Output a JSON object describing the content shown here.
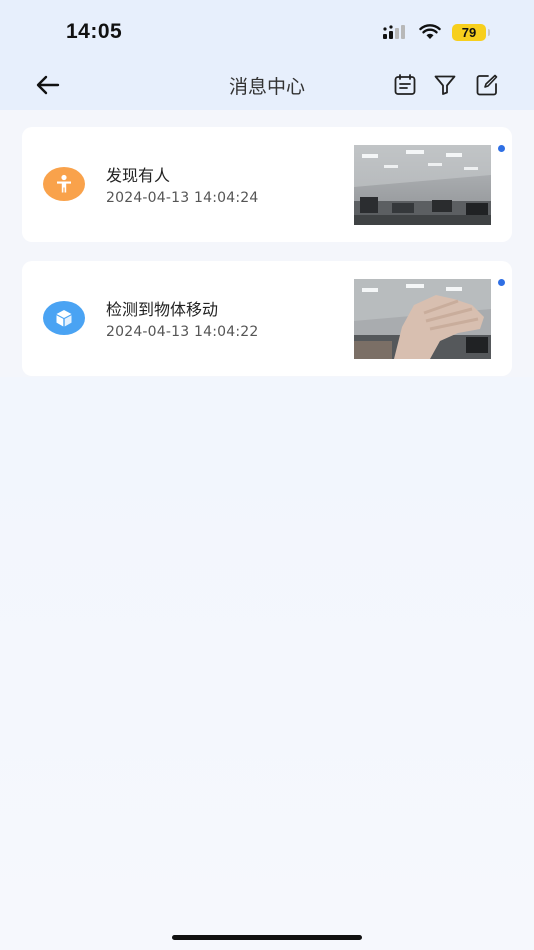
{
  "status_bar": {
    "time": "14:05",
    "battery": "79"
  },
  "header": {
    "title": "消息中心",
    "back_icon": "arrow-left-icon",
    "actions": [
      "calendar-icon",
      "filter-icon",
      "edit-icon"
    ]
  },
  "messages": [
    {
      "title": "发现有人",
      "time": "2024-04-13 14:04:24",
      "icon": "person-icon",
      "icon_color": "#f9a24b",
      "unread": true
    },
    {
      "title": "检测到物体移动",
      "time": "2024-04-13 14:04:22",
      "icon": "cube-icon",
      "icon_color": "#4aa3f3",
      "unread": true
    }
  ],
  "colors": {
    "unread_dot": "#2f6fe4",
    "battery": "#f7cf1d"
  }
}
